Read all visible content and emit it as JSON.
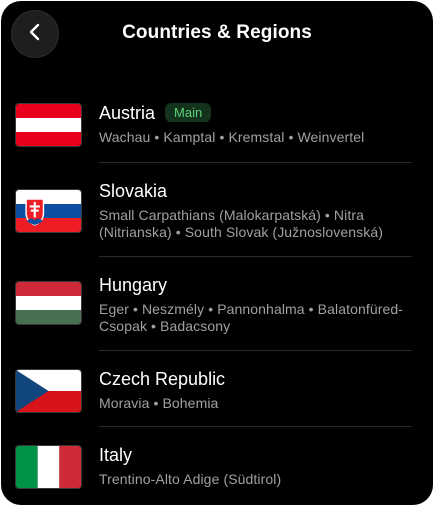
{
  "header": {
    "title": "Countries & Regions",
    "back_icon": "chevron-left-icon"
  },
  "countries": [
    {
      "name": "Austria",
      "badge": "Main",
      "regions": "Wachau • Kamptal • Kremstal • Weinvertel",
      "flag_colors": [
        "#e8001c",
        "#ffffff",
        "#e8001c"
      ]
    },
    {
      "name": "Slovakia",
      "regions": "Small Carpathians (Malokarpatská) • Nitra (Nitrianska) • South Slovak (Južnoslovenská)",
      "flag_colors": [
        "#ffffff",
        "#0b4ea2",
        "#ee1c25"
      ]
    },
    {
      "name": "Hungary",
      "regions": "Eger • Neszmély • Pannonhalma • Balatonfüred-Csopak • Badacsony",
      "flag_colors": [
        "#ce2939",
        "#ffffff",
        "#477050"
      ]
    },
    {
      "name": "Czech Republic",
      "regions": "Moravia • Bohemia",
      "flag_colors": [
        "#ffffff",
        "#d7141a",
        "#11457e"
      ]
    },
    {
      "name": "Italy",
      "regions": "Trentino-Alto Adige (Südtirol)",
      "flag_colors": [
        "#009246",
        "#ffffff",
        "#ce2b37"
      ]
    }
  ],
  "colors": {
    "background": "#000000",
    "badge_bg": "#14331c",
    "badge_text": "#5fd07a",
    "secondary_text": "#a0a0a5"
  }
}
